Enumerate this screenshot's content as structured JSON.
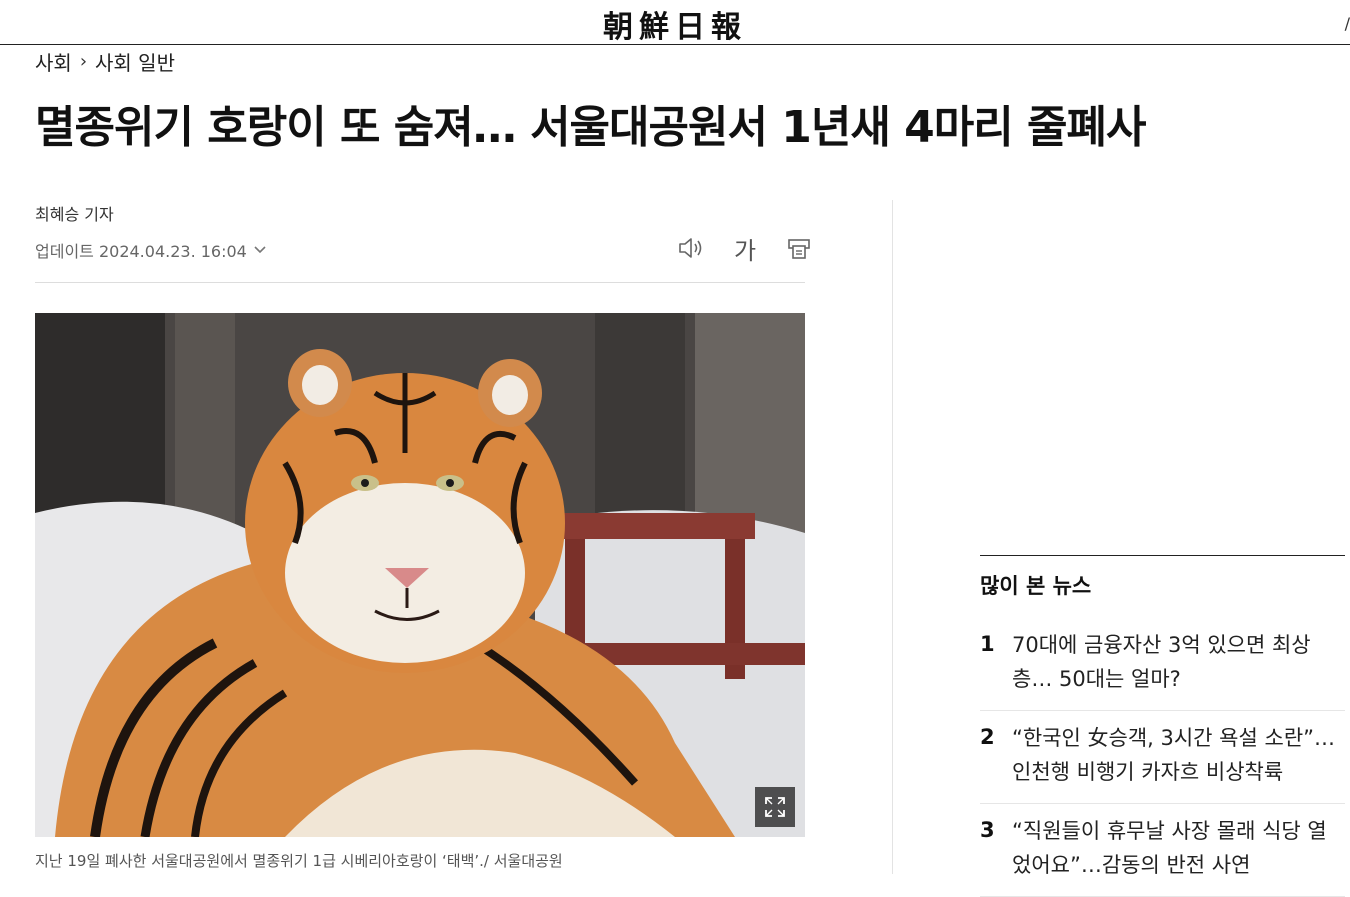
{
  "masthead": {
    "logo": "朝鮮日報",
    "edge_mark": "/"
  },
  "breadcrumb": {
    "section": "사회",
    "separator": "›",
    "subsection": "사회 일반"
  },
  "article": {
    "headline": "멸종위기 호랑이 또 숨져… 서울대공원서 1년새 4마리 줄폐사",
    "byline": "최혜승 기자",
    "updated": "업데이트 2024.04.23. 16:04",
    "tools": {
      "font_label": "가"
    },
    "photo": {
      "icon": "expand-icon"
    },
    "caption": "지난 19일 폐사한 서울대공원에서 멸종위기 1급 시베리아호랑이 ‘태백’./ 서울대공원"
  },
  "popular_news": {
    "title": "많이 본 뉴스",
    "items": [
      {
        "rank": "1",
        "text": "70대에 금융자산 3억 있으면 최상층… 50대는 얼마?"
      },
      {
        "rank": "2",
        "text": "“한국인 女승객, 3시간 욕설 소란”… 인천행 비행기 카자흐 비상착륙"
      },
      {
        "rank": "3",
        "text": "“직원들이 휴무날 사장 몰래 식당 열었어요”…감동의 반전 사연"
      }
    ]
  },
  "colors": {
    "text": "#111111",
    "muted": "#666666",
    "rule": "#dddddd"
  }
}
